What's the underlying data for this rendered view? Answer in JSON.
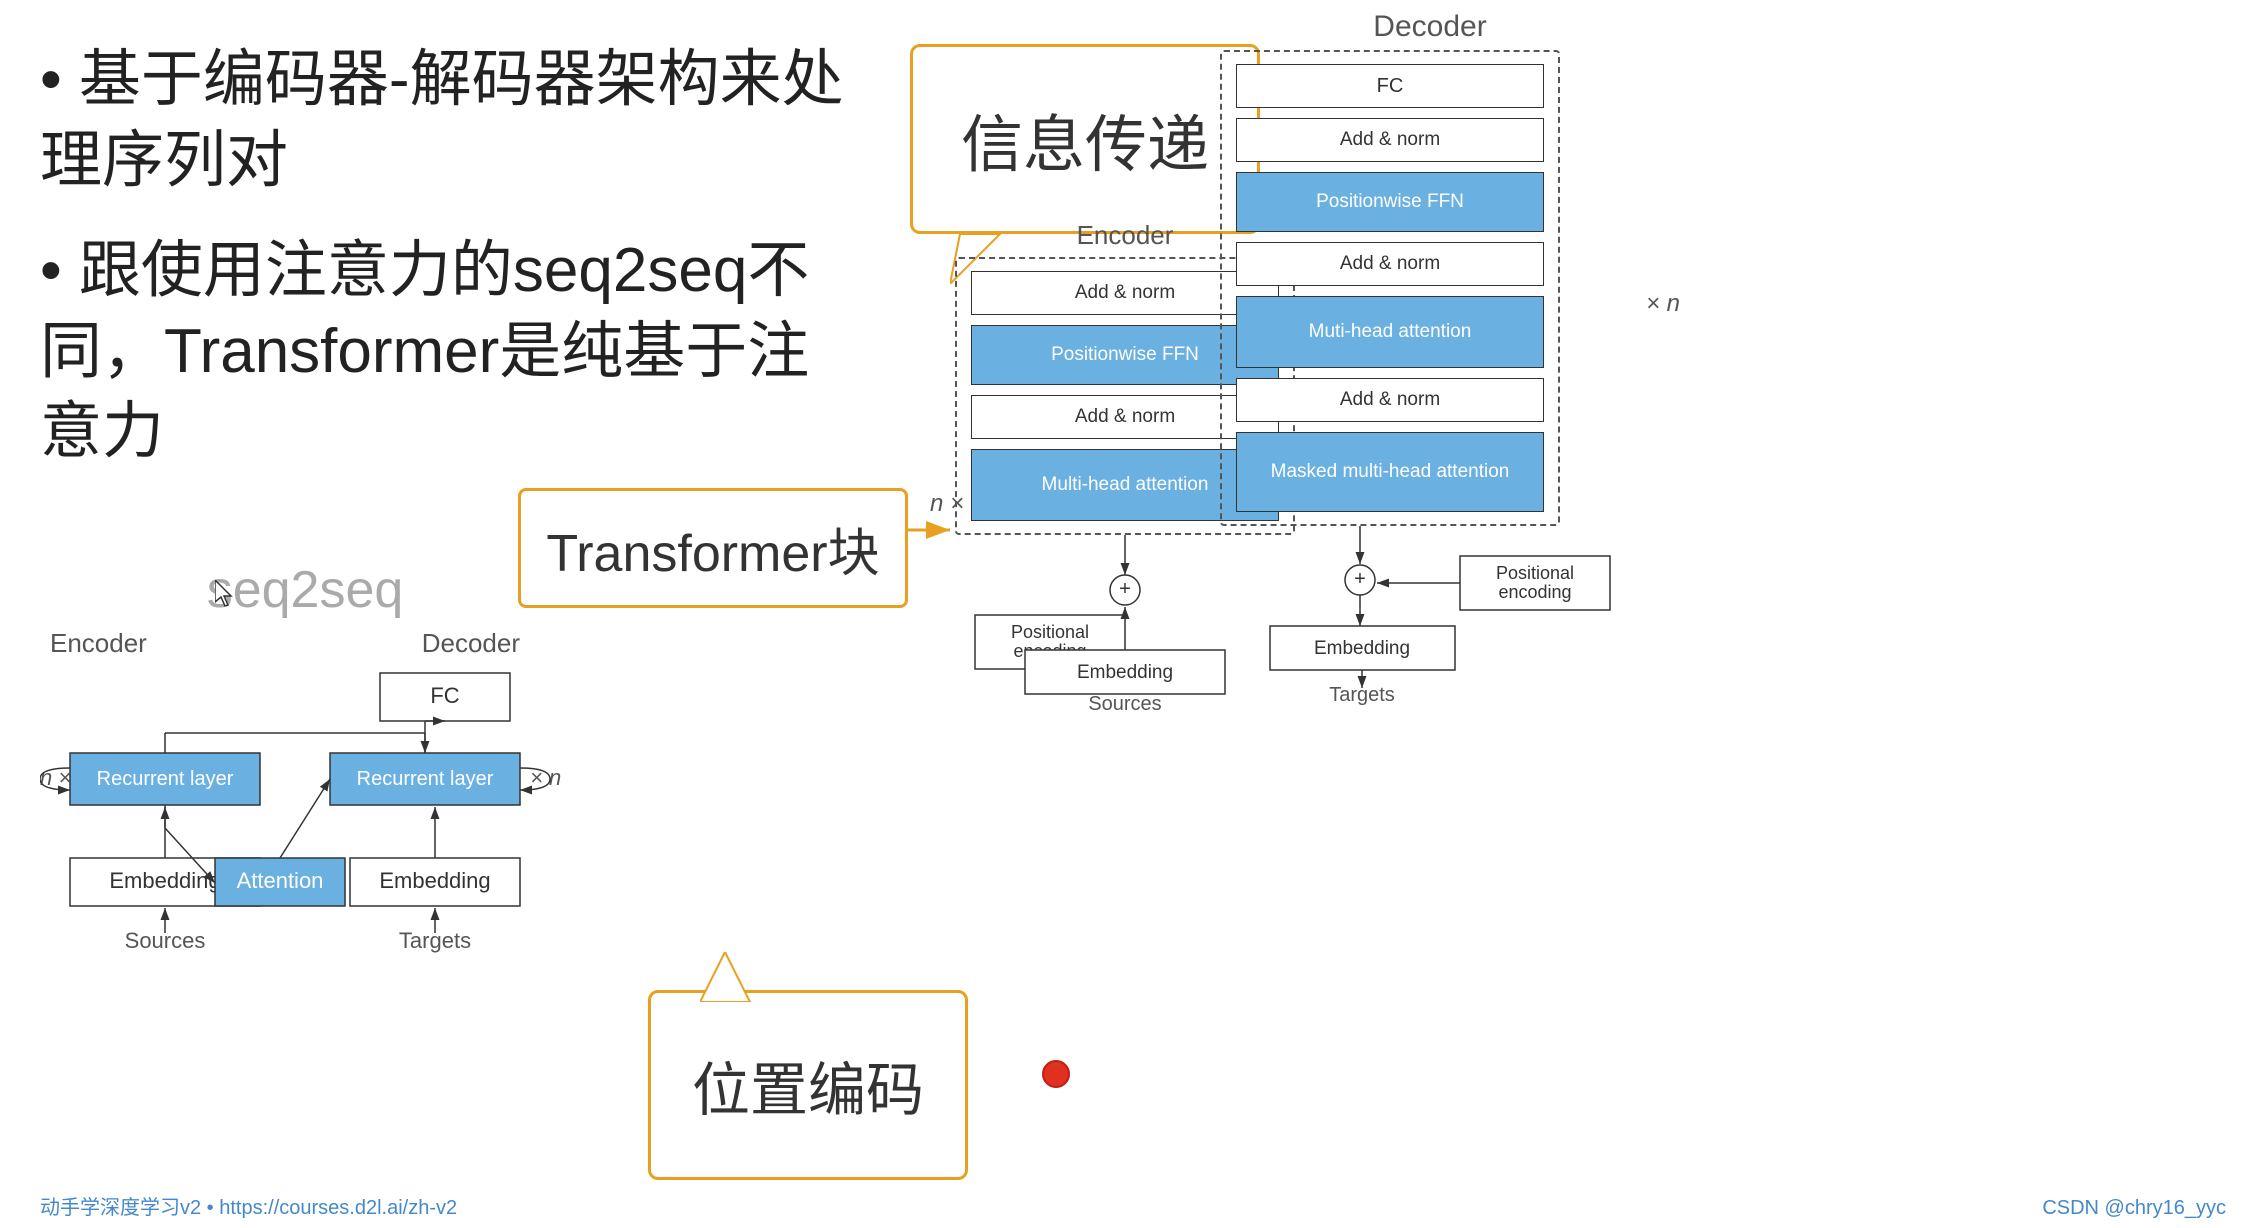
{
  "slide": {
    "bullet1": "• 基于编码器-解码器架构来处理序列对",
    "bullet2": "• 跟使用注意力的seq2seq不同，Transformer是纯基于注意力",
    "seq2seq_title": "seq2seq",
    "encoder_label": "Encoder",
    "decoder_label_seq": "Decoder",
    "decoder_label_main": "Decoder",
    "encoder_label_main": "Encoder",
    "fc_label": "FC",
    "recurrent_encoder": "Recurrent layer",
    "recurrent_decoder": "Recurrent layer",
    "embedding_left": "Embedding",
    "attention_label": "Attention",
    "embedding_mid": "Embedding",
    "sources_left": "Sources",
    "targets_label": "Targets",
    "n_times_left": "n ×",
    "x_n_left": "× n",
    "transformer_block_label": "Transformer块",
    "info_bubble_text": "信息传递",
    "pos_bubble_text": "位置编码",
    "add_norm_1_enc": "Add & norm",
    "poswise_ffn_enc": "Positionwise FFN",
    "add_norm_2_enc": "Add & norm",
    "multihead_enc": "Multi-head attention",
    "positional_enc_label": "Positional encoding",
    "plus_enc": "+",
    "embedding_enc": "Embedding",
    "sources_enc": "Sources",
    "add_norm_1_dec": "Add & norm",
    "fc_dec": "FC",
    "poswise_ffn_dec": "Positionwise FFN",
    "add_norm_2_dec": "Add & norm",
    "multihead_dec": "Muti-head attention",
    "add_norm_3_dec": "Add & norm",
    "masked_multihead_dec": "Masked multi-head attention",
    "positional_dec_label": "Positional encoding",
    "plus_dec": "+",
    "embedding_dec": "Embedding",
    "targets_dec": "Targets",
    "x_n_dec": "× n",
    "x_n_enc": "n ×",
    "watermark": "动手学深度学习v2 • https://courses.d2l.ai/zh-v2",
    "watermark_right": "CSDN @chry16_yyc"
  }
}
